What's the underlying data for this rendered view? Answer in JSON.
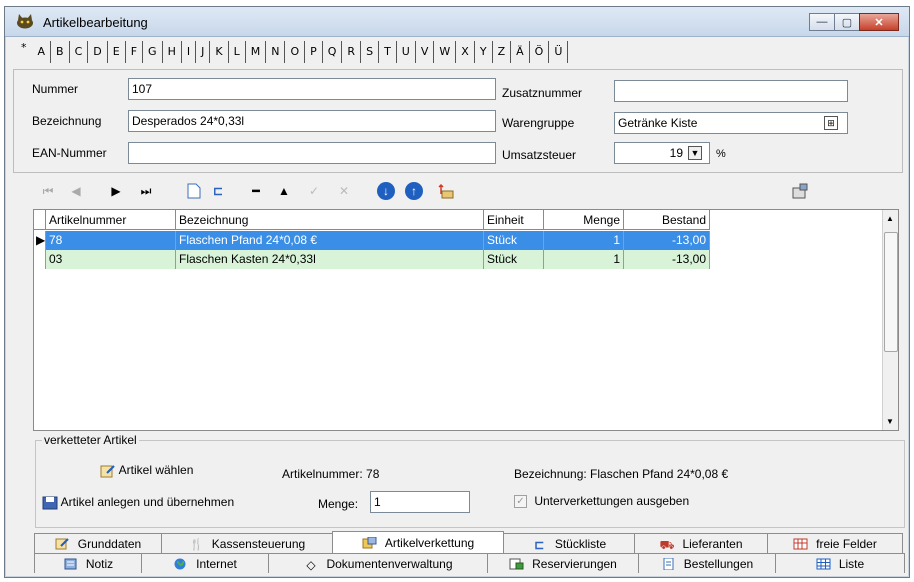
{
  "window": {
    "title": "Artikelbearbeitung",
    "min": "—",
    "max": "▢",
    "close": "✕"
  },
  "alphabet": [
    "*",
    "A",
    "B",
    "C",
    "D",
    "E",
    "F",
    "G",
    "H",
    "I",
    "J",
    "K",
    "L",
    "M",
    "N",
    "O",
    "P",
    "Q",
    "R",
    "S",
    "T",
    "U",
    "V",
    "W",
    "X",
    "Y",
    "Z",
    "Ä",
    "Ö",
    "Ü"
  ],
  "form": {
    "nummer_label": "Nummer",
    "nummer_value": "107",
    "bezeichnung_label": "Bezeichnung",
    "bezeichnung_value": "Desperados 24*0,33l",
    "ean_label": "EAN-Nummer",
    "ean_value": "",
    "zusatznummer_label": "Zusatznummer",
    "zusatznummer_value": "",
    "warengruppe_label": "Warengruppe",
    "warengruppe_value": "Getränke Kiste",
    "umsatzsteuer_label": "Umsatzsteuer",
    "umsatzsteuer_value": "19",
    "umsatzsteuer_unit": "%"
  },
  "grid": {
    "headers": [
      "Artikelnummer",
      "Bezeichnung",
      "Einheit",
      "Menge",
      "Bestand"
    ],
    "rows": [
      {
        "artikelnummer": "78",
        "bezeichnung": "Flaschen Pfand 24*0,08 €",
        "einheit": "Stück",
        "menge": "1",
        "bestand": "-13,00"
      },
      {
        "artikelnummer": "03",
        "bezeichnung": "Flaschen Kasten 24*0,33l",
        "einheit": "Stück",
        "menge": "1",
        "bestand": "-13,00"
      }
    ]
  },
  "linked": {
    "group_title": "verketteter Artikel",
    "choose_label": "Artikel wählen",
    "create_label": "Artikel anlegen und übernehmen",
    "artikelnummer_text": "Artikelnummer: 78",
    "bezeichnung_text": "Bezeichnung: Flaschen Pfand 24*0,08 €",
    "menge_label": "Menge:",
    "menge_value": "1",
    "sub_label": "Unterverkettungen ausgeben",
    "sub_checked": true
  },
  "tabs_row1": [
    "Grunddaten",
    "Kassensteuerung",
    "Artikelverkettung",
    "Stückliste",
    "Lieferanten",
    "freie Felder"
  ],
  "tabs_row2": [
    "Notiz",
    "Internet",
    "Dokumentenverwaltung",
    "Reservierungen",
    "Bestellungen",
    "Liste"
  ],
  "colors": {
    "selected_row": "#3b8ee6",
    "alt_row": "#d8f3d8",
    "title_bar": "#c7d7ea"
  }
}
